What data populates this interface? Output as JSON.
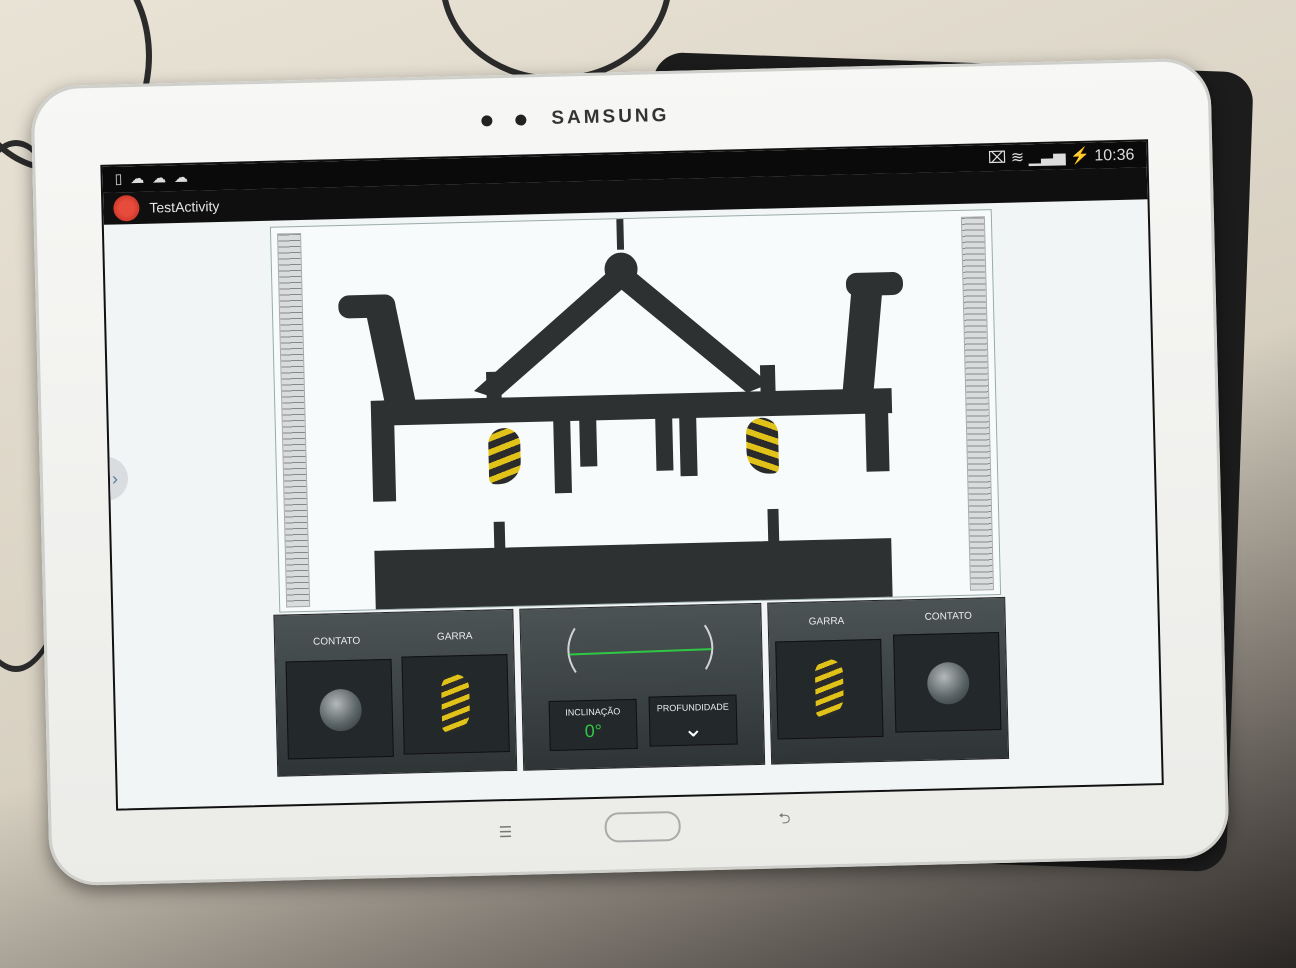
{
  "device": {
    "brand": "SAMSUNG"
  },
  "statusbar": {
    "notifications": "▯ ☁ ☁ ☁",
    "time": "10:36",
    "signal_icons": "⌧ ≋ ▁▃▅ ⚡"
  },
  "actionbar": {
    "title": "TestActivity"
  },
  "left_panel": {
    "contact_label": "CONTATO",
    "claw_label": "GARRA"
  },
  "center_panel": {
    "inclination_label": "INCLINAÇÃO",
    "inclination_value": "0°",
    "depth_label": "PROFUNDIDADE"
  },
  "right_panel": {
    "claw_label": "GARRA",
    "contact_label": "CONTATO"
  },
  "nav_buttons": {
    "menu": "☰",
    "back": "⮌"
  },
  "colors": {
    "level_line": "#2fc845",
    "claw_stripe": "#e0c218",
    "frame": "#2e3132"
  }
}
